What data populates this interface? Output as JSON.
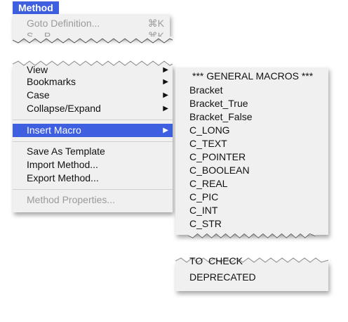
{
  "menu_bar": {
    "title": "Method"
  },
  "top_fragment": {
    "item1": {
      "label": "Goto Definition...",
      "shortcut": "⌘K"
    },
    "item2": {
      "label": "S... P...",
      "shortcut": "⌘K"
    }
  },
  "main_menu": {
    "view": "View",
    "bookmarks": "Bookmarks",
    "case": "Case",
    "collapse": "Collapse/Expand",
    "insert_macro": "Insert Macro",
    "save_template": "Save As Template",
    "import": "Import Method...",
    "export": "Export Method...",
    "properties": "Method Properties..."
  },
  "submenu": {
    "items": [
      "*** GENERAL MACROS ***",
      "Bracket",
      "Bracket_True",
      "Bracket_False",
      "C_LONG",
      "C_TEXT",
      "C_POINTER",
      "C_BOOLEAN",
      "C_REAL",
      "C_PIC",
      "C_INT",
      "C_STR"
    ],
    "tail_items": [
      "TO_CHECK",
      "DEPRECATED"
    ]
  },
  "colors": {
    "highlight": "#3d5fe0",
    "menu_bg": "#f0f0f0",
    "disabled": "#9a9a9a"
  }
}
